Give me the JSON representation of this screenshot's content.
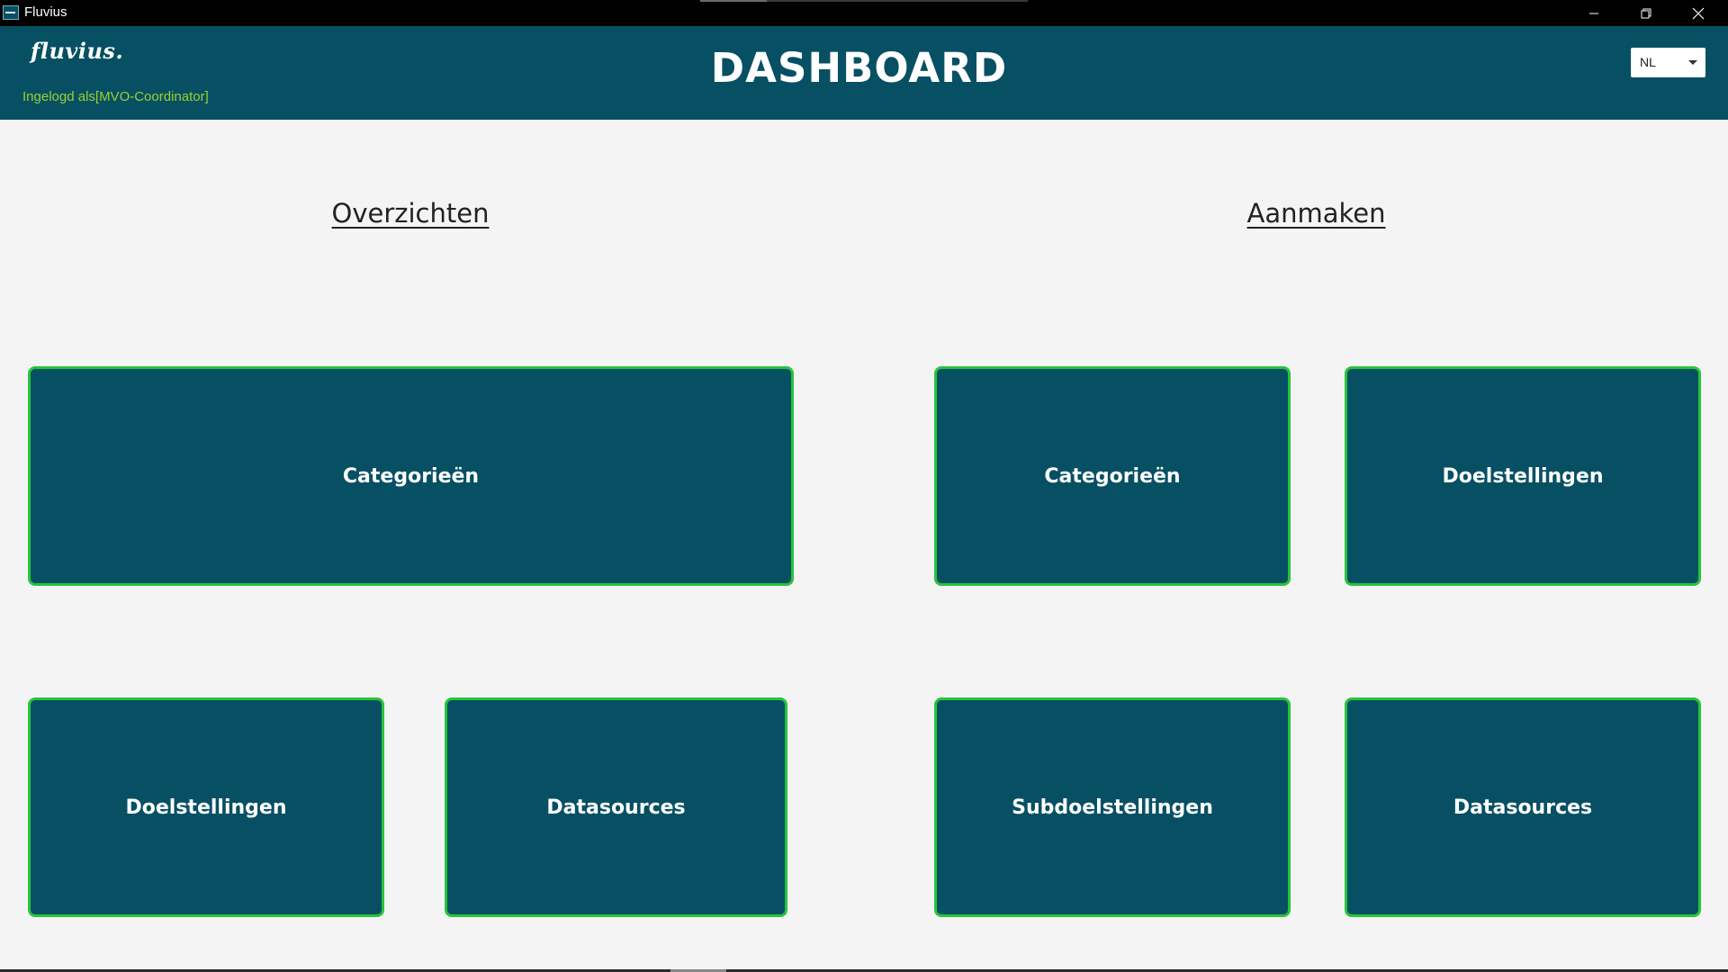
{
  "window": {
    "title": "Fluvius",
    "icon": "fluvius-app-icon",
    "controls": [
      "minimize-icon",
      "restore-icon",
      "close-icon"
    ]
  },
  "header": {
    "logo_text": "fluvius.",
    "login_status": "Ingelogd als[MVO-Coordinator]",
    "title": "DASHBOARD",
    "language": {
      "selected": "NL"
    }
  },
  "sections": {
    "overview": {
      "heading": "Overzichten",
      "tiles": [
        "Categorieën",
        "Doelstellingen",
        "Datasources"
      ]
    },
    "create": {
      "heading": "Aanmaken",
      "tiles": [
        "Categorieën",
        "Doelstellingen",
        "Subdoelstellingen",
        "Datasources"
      ]
    }
  },
  "colors": {
    "header_bg": "#075064",
    "tile_bg": "#075064",
    "tile_border": "#28c43a",
    "login_text": "#9bd12e",
    "page_bg": "#f4f4f4"
  }
}
